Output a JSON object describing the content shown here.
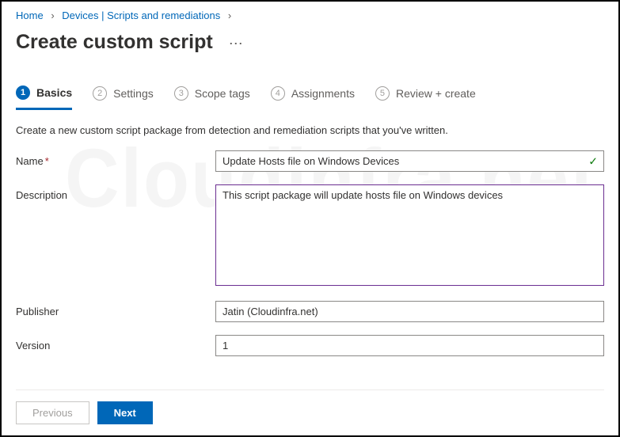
{
  "breadcrumb": {
    "home": "Home",
    "devices": "Devices | Scripts and remediations"
  },
  "page_title": "Create custom script",
  "watermark": "Cloudinfra.net",
  "wizard": {
    "steps": [
      {
        "num": "1",
        "label": "Basics"
      },
      {
        "num": "2",
        "label": "Settings"
      },
      {
        "num": "3",
        "label": "Scope tags"
      },
      {
        "num": "4",
        "label": "Assignments"
      },
      {
        "num": "5",
        "label": "Review + create"
      }
    ]
  },
  "intro": "Create a new custom script package from detection and remediation scripts that you've written.",
  "form": {
    "name_label": "Name",
    "name_value": "Update Hosts file on Windows Devices",
    "description_label": "Description",
    "description_value": "This script package will update hosts file on Windows devices",
    "publisher_label": "Publisher",
    "publisher_value": "Jatin (Cloudinfra.net)",
    "version_label": "Version",
    "version_value": "1"
  },
  "buttons": {
    "previous": "Previous",
    "next": "Next"
  }
}
